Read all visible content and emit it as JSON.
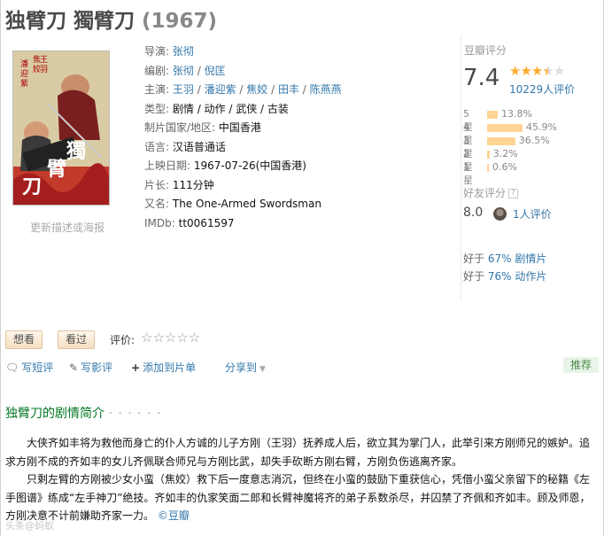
{
  "title": {
    "name": "独臂刀 獨臂刀",
    "year": "(1967)"
  },
  "poster": {
    "update_link": "更新描述或海报",
    "chars": [
      "潘",
      "迎",
      "紫",
      "王",
      "羽",
      "焦",
      "姣",
      "獨",
      "臂",
      "刀"
    ]
  },
  "info": {
    "director": {
      "label": "导演:",
      "names": [
        "张彻"
      ]
    },
    "writer": {
      "label": "编剧:",
      "names": [
        "张彻",
        "倪匡"
      ]
    },
    "cast": {
      "label": "主演:",
      "names": [
        "王羽",
        "潘迎紫",
        "焦姣",
        "田丰",
        "陈燕燕"
      ]
    },
    "genre": {
      "label": "类型:",
      "value": "剧情 / 动作 / 武侠 / 古装"
    },
    "region": {
      "label": "制片国家/地区:",
      "value": "中国香港"
    },
    "language": {
      "label": "语言:",
      "value": "汉语普通话"
    },
    "release": {
      "label": "上映日期:",
      "value": "1967-07-26(中国香港)"
    },
    "runtime": {
      "label": "片长:",
      "value": "111分钟"
    },
    "aka": {
      "label": "又名:",
      "value": "The One-Armed Swordsman"
    },
    "imdb": {
      "label": "IMDb:",
      "value": "tt0061597"
    }
  },
  "rating": {
    "label": "豆瓣评分",
    "score": "7.4",
    "stars": 3.5,
    "votes": "10229人评价",
    "distribution": [
      {
        "label": "5星",
        "percent": 13.8,
        "text": "13.8%"
      },
      {
        "label": "4星",
        "percent": 45.9,
        "text": "45.9%"
      },
      {
        "label": "3星",
        "percent": 36.5,
        "text": "36.5%"
      },
      {
        "label": "2星",
        "percent": 3.2,
        "text": "3.2%"
      },
      {
        "label": "1星",
        "percent": 0.6,
        "text": "0.6%"
      }
    ],
    "friend": {
      "label": "好友评分",
      "q": "?",
      "score": "8.0",
      "count": "1人评价"
    },
    "better_than": [
      {
        "prefix": "好于",
        "percent": "67%",
        "genre": "剧情片"
      },
      {
        "prefix": "好于",
        "percent": "76%",
        "genre": "动作片"
      }
    ]
  },
  "interest": {
    "want": "想看",
    "seen": "看过",
    "rate_label": "评价:",
    "rate_stars": "☆☆☆☆☆"
  },
  "actions": {
    "short_review": "写短评",
    "review": "写影评",
    "add_list": "添加到片单",
    "share": "分享到",
    "recommend": "推荐"
  },
  "summary": {
    "title": "独臂刀的剧情简介",
    "dots": "· · · · · ·",
    "p1": "大侠齐如丰将为救他而身亡的仆人方诚的儿子方刚（王羽）抚养成人后，欲立其为掌门人，此举引来方刚师兄的嫉妒。追求方刚不成的齐如丰的女儿齐佩联合师兄与方刚比武，却失手砍断方刚右臂，方刚负伤逃离齐家。",
    "p2": "只剩左臂的方刚被少女小蛮（焦姣）救下后一度意志消沉，但终在小蛮的鼓励下重获信心，凭借小蛮父亲留下的秘籍《左手图谱》练成“左手神刀”绝技。齐如丰的仇家笑面二郎和长臂神魔将齐的弟子系数杀尽，并囚禁了齐佩和齐如丰。顾及师恩，方刚决意不计前嫌助齐家一力。",
    "source": "©豆瓣"
  },
  "watermark": "头条@蚂蚁"
}
